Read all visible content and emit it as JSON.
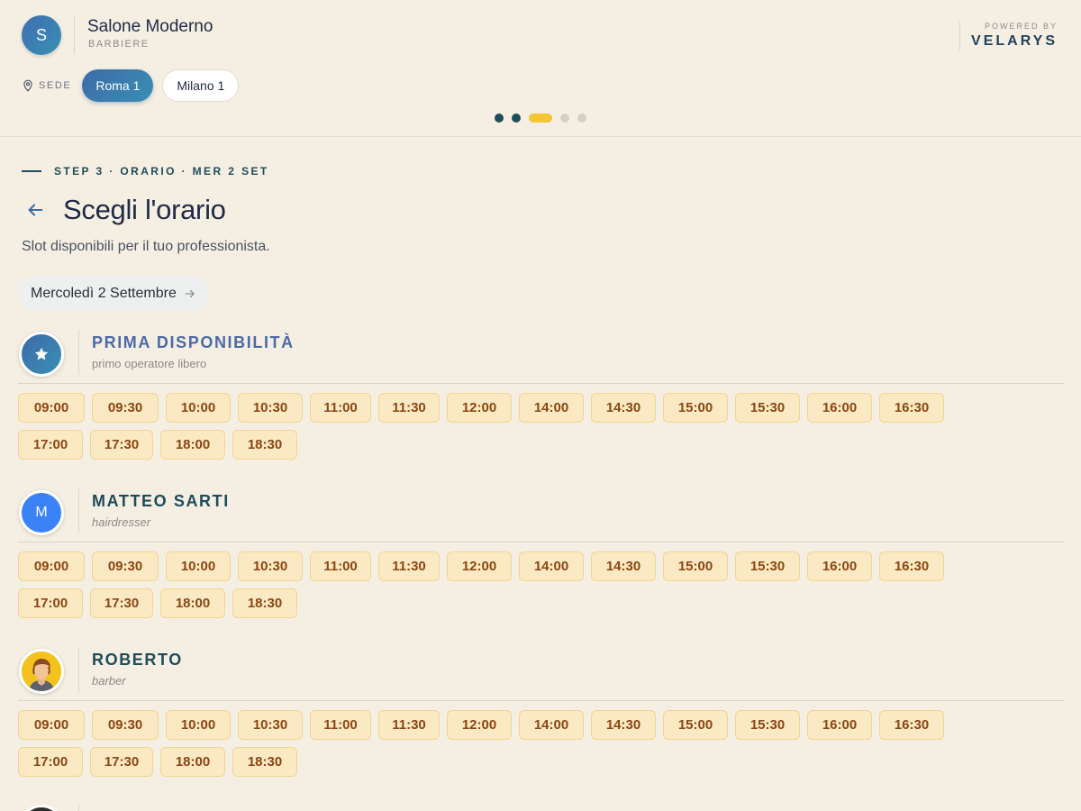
{
  "salon": {
    "initial": "S",
    "name": "Salone Moderno",
    "type": "BARBIERE"
  },
  "powered": {
    "label": "POWERED BY",
    "brand": "VELARYS"
  },
  "sede": {
    "label": "SEDE",
    "options": [
      {
        "label": "Roma 1",
        "active": true
      },
      {
        "label": "Milano 1",
        "active": false
      }
    ]
  },
  "progress": {
    "total": 5,
    "current": 3
  },
  "step": {
    "text": "STEP 3 · ORARIO · MER 2 SET"
  },
  "page": {
    "title": "Scegli l'orario",
    "subtitle": "Slot disponibili per il tuo professionista.",
    "date_label": "Mercoledì 2 Settembre"
  },
  "staff": [
    {
      "name": "PRIMA DISPONIBILITÀ",
      "role": "primo operatore libero",
      "avatar": "star-icon",
      "slots": [
        "09:00",
        "09:30",
        "10:00",
        "10:30",
        "11:00",
        "11:30",
        "12:00",
        "14:00",
        "14:30",
        "15:00",
        "15:30",
        "16:00",
        "16:30",
        "17:00",
        "17:30",
        "18:00",
        "18:30"
      ]
    },
    {
      "name": "MATTEO SARTI",
      "role": "hairdresser",
      "avatar": "M",
      "slots": [
        "09:00",
        "09:30",
        "10:00",
        "10:30",
        "11:00",
        "11:30",
        "12:00",
        "14:00",
        "14:30",
        "15:00",
        "15:30",
        "16:00",
        "16:30",
        "17:00",
        "17:30",
        "18:00",
        "18:30"
      ]
    },
    {
      "name": "ROBERTO",
      "role": "barber",
      "avatar": "person-illustration",
      "slots": [
        "09:00",
        "09:30",
        "10:00",
        "10:30",
        "11:00",
        "11:30",
        "12:00",
        "14:00",
        "14:30",
        "15:00",
        "15:30",
        "16:00",
        "16:30",
        "17:00",
        "17:30",
        "18:00",
        "18:30"
      ]
    }
  ],
  "colors": {
    "background": "#f5efe3",
    "accent": "#1e4c59",
    "brand_gradient_start": "#3d6aa8",
    "brand_gradient_end": "#3a8fb5",
    "slot_bg": "#fbe9c3",
    "slot_text": "#8a4613",
    "progress_current": "#f5c533"
  }
}
